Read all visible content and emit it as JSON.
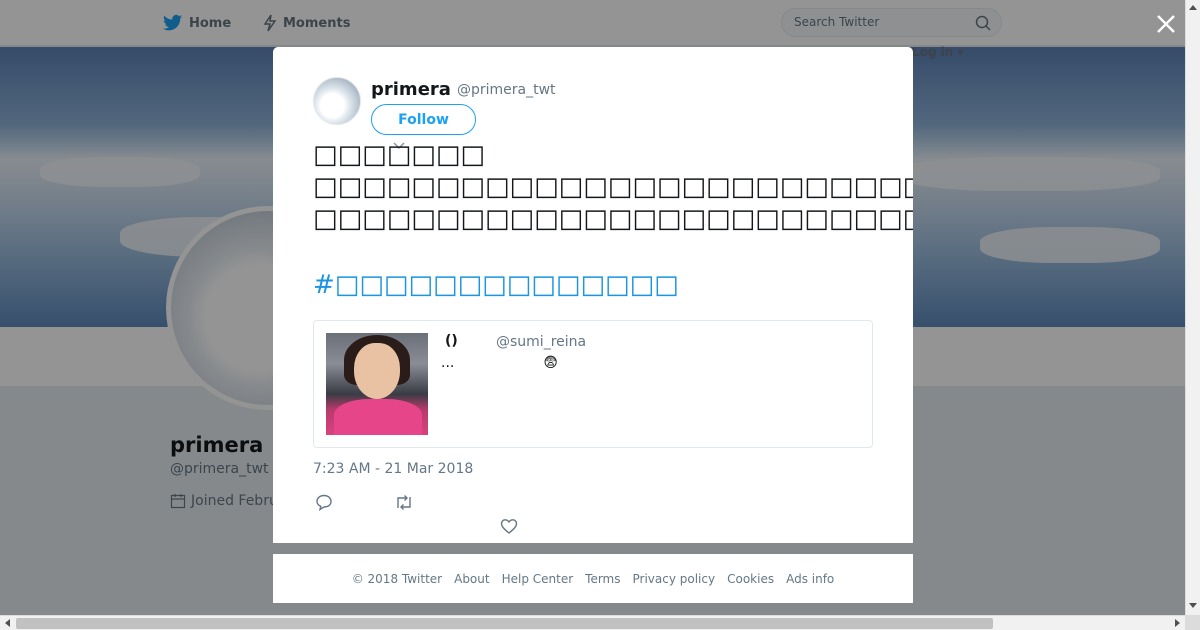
{
  "nav": {
    "home_label": "Home",
    "moments_label": "Moments",
    "search_placeholder": "Search Twitter",
    "login_label": "Log in ▾"
  },
  "profile": {
    "name": "primera",
    "handle": "@primera_twt",
    "joined": "Joined Febru"
  },
  "modal": {
    "name": "primera",
    "handle": "@primera_twt",
    "follow_label": "Follow",
    "tweet_line1": "□□□□□□□",
    "tweet_line2": "□□□□□□□□□□□□□□□□□□□□□□□□□□□□□□□P□□□□□□□□□□□□□□□□□□□□□□□□□□□□",
    "tweet_line3": "□□□□□□□□□□□□□□□□□□□□□□□□□□□□□□□□□□□□□□□□□□□□□□□□□□□□□□□□□□□□□□□□□□□□□",
    "hashtag": "#□□□□□□□□□□□□□□",
    "quote": {
      "name": "()",
      "handle": "@sumi_reina",
      "text": "...                    😨"
    },
    "timestamp": "7:23 AM - 21 Mar 2018"
  },
  "footer": {
    "links": [
      "© 2018 Twitter",
      "About",
      "Help Center",
      "Terms",
      "Privacy policy",
      "Cookies",
      "Ads info"
    ]
  },
  "colors": {
    "twitter_blue": "#1da1f2",
    "hashtag_blue": "#1b95e0",
    "muted_gray": "#657786"
  },
  "icons": [
    "twitter-bird-icon",
    "lightning-icon",
    "search-icon",
    "close-icon",
    "calendar-icon",
    "reply-icon",
    "retweet-icon",
    "like-icon",
    "caret-down-icon"
  ]
}
